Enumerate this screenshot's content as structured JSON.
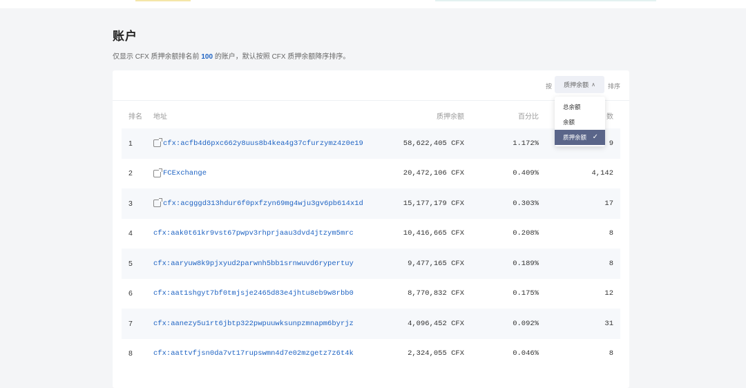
{
  "page": {
    "title": "账户",
    "desc_prefix": "仅显示 CFX 质押余额排名前",
    "desc_count": "100",
    "desc_suffix": "的账户，默认按照 CFX 质押余额降序排序。"
  },
  "sort": {
    "prefix": "按",
    "selected": "质押余额",
    "suffix": "排序",
    "options": [
      "总余额",
      "余额",
      "质押余额"
    ]
  },
  "table": {
    "columns": {
      "rank": "排名",
      "address": "地址",
      "staking_balance": "质押余额",
      "percentage": "百分比",
      "count": "数"
    },
    "rows": [
      {
        "rank": "1",
        "address": "cfx:acfb4d6pxc662y8uus8b4kea4g37cfurzymz4z0e19",
        "contract": true,
        "balance": "58,622,405 CFX",
        "pct": "1.172%",
        "count": "9"
      },
      {
        "rank": "2",
        "address": "FCExchange",
        "contract": true,
        "balance": "20,472,106 CFX",
        "pct": "0.409%",
        "count": "4,142"
      },
      {
        "rank": "3",
        "address": "cfx:acgggd313hdur6f0pxfzyn69mg4wju3gv6pb614x1d",
        "contract": true,
        "balance": "15,177,179 CFX",
        "pct": "0.303%",
        "count": "17"
      },
      {
        "rank": "4",
        "address": "cfx:aak0t61kr9vst67pwpv3rhprjaau3dvd4jtzym5mrc",
        "contract": false,
        "balance": "10,416,665 CFX",
        "pct": "0.208%",
        "count": "8"
      },
      {
        "rank": "5",
        "address": "cfx:aaryuw8k9pjxyud2parwnh5bb1srnwuvd6rypertuy",
        "contract": false,
        "balance": "9,477,165 CFX",
        "pct": "0.189%",
        "count": "8"
      },
      {
        "rank": "6",
        "address": "cfx:aat1shgyt7bf0tmjsje2465d83e4jhtu8eb9w8rbb0",
        "contract": false,
        "balance": "8,770,832 CFX",
        "pct": "0.175%",
        "count": "12"
      },
      {
        "rank": "7",
        "address": "cfx:aanezy5u1rt6jbtp322pwpuuwksunpzmnapm6byrjz",
        "contract": false,
        "balance": "4,096,452 CFX",
        "pct": "0.092%",
        "count": "31"
      },
      {
        "rank": "8",
        "address": "cfx:aattvfjsn0da7vt17rupswmn4d7e02mzgetz7z6t4k",
        "contract": false,
        "balance": "2,324,055 CFX",
        "pct": "0.046%",
        "count": "8"
      }
    ]
  }
}
